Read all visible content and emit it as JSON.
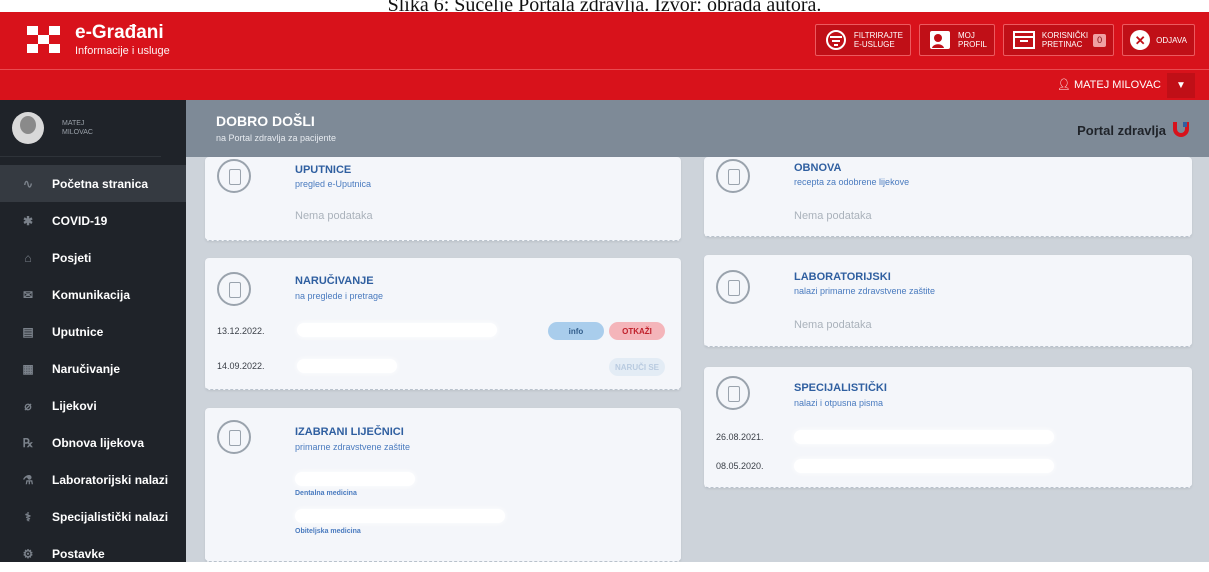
{
  "caption": "Slika 6: Sučelje Portala zdravlja. Izvor: obrada autora.",
  "header": {
    "title": "e-Građani",
    "subtitle": "Informacije i usluge",
    "buttons": [
      {
        "line1": "FILTRIRAJTE",
        "line2": "E-USLUGE"
      },
      {
        "line1": "MOJ",
        "line2": "PROFIL"
      },
      {
        "line1": "KORISNIČKI",
        "line2": "PRETINAC",
        "badge": "0"
      },
      {
        "label": "ODJAVA"
      }
    ]
  },
  "user": {
    "name": "MATEJ MILOVAC",
    "side_first": "MATEJ",
    "side_last": "MILOVAC"
  },
  "sidebar": {
    "items": [
      {
        "label": "Početna stranica",
        "icon": "pulse-icon"
      },
      {
        "label": "COVID-19",
        "icon": "virus-icon"
      },
      {
        "label": "Posjeti",
        "icon": "home-icon"
      },
      {
        "label": "Komunikacija",
        "icon": "chat-icon"
      },
      {
        "label": "Uputnice",
        "icon": "document-icon"
      },
      {
        "label": "Naručivanje",
        "icon": "calendar-icon"
      },
      {
        "label": "Lijekovi",
        "icon": "pill-icon"
      },
      {
        "label": "Obnova lijekova",
        "icon": "prescription-icon"
      },
      {
        "label": "Laboratorijski nalazi",
        "icon": "flask-icon"
      },
      {
        "label": "Specijalistički nalazi",
        "icon": "doctor-icon"
      },
      {
        "label": "Postavke",
        "icon": "gear-icon"
      }
    ]
  },
  "welcome": {
    "title": "DOBRO DOŠLI",
    "subtitle": "na Portal zdravlja za pacijente",
    "portal": "Portal zdravlja"
  },
  "cards": {
    "uputnice": {
      "title": "UPUTNICE",
      "subtitle": "pregled e-Uputnica",
      "empty": "Nema podataka"
    },
    "obnova": {
      "title": "OBNOVA",
      "subtitle": "recepta za odobrene lijekove",
      "empty": "Nema podataka"
    },
    "narucivanje": {
      "title": "NARUČIVANJE",
      "subtitle": "na preglede i pretrage",
      "rows": [
        {
          "date": "13.12.2022.",
          "info": "info",
          "cancel": "OTKAŽI"
        },
        {
          "date": "14.09.2022.",
          "book": "NARUČI SE"
        }
      ]
    },
    "laboratorijski": {
      "title": "LABORATORIJSKI",
      "subtitle": "nalazi primarne zdravstvene zaštite",
      "empty": "Nema podataka"
    },
    "specijalisticki": {
      "title": "SPECIJALISTIČKI",
      "subtitle": "nalazi i otpusna pisma",
      "rows": [
        {
          "date": "26.08.2021."
        },
        {
          "date": "08.05.2020."
        }
      ]
    },
    "lijecnici": {
      "title": "IZABRANI LIJEČNICI",
      "subtitle": "primarne zdravstvene zaštite",
      "categories": [
        "Dentalna medicina",
        "Obiteljska medicina"
      ]
    }
  }
}
